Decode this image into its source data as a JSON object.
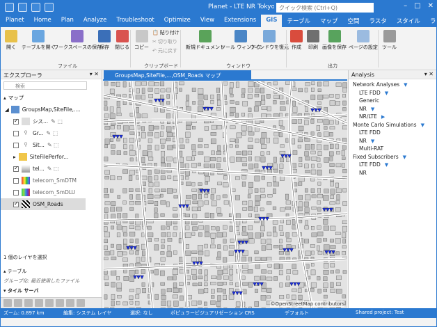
{
  "window": {
    "title": "Planet - LTE NR Tokyo S",
    "quick_search_placeholder": "クイック検索 (Ctrl+Q)",
    "controls": [
      "–",
      "□",
      "✕"
    ]
  },
  "tabs": [
    "Planet",
    "Home",
    "Plan",
    "Analyze",
    "Troubleshoot",
    "Optimize",
    "View",
    "Extensions",
    "GIS",
    "テーブル",
    "マップ",
    "空間",
    "ラスタ",
    "スタイル",
    "ラベル"
  ],
  "ribbon": {
    "file": {
      "label": "ファイル",
      "buttons": [
        "開く",
        "テーブルを開く",
        "ワークスペースの保存",
        "保存",
        "閉じる"
      ]
    },
    "clipboard": {
      "label": "クリップボード",
      "copy": "コピー",
      "paste": "貼り付け",
      "cut": "切り取り",
      "paste_special": "元に戻す"
    },
    "window": {
      "label": "ウィンドウ",
      "new_document": "新規ドキュメント",
      "tool_window": "ツール ウィンドウ",
      "restore_window": "ウィンドウを復元"
    },
    "output": {
      "label": "出力",
      "buttons": [
        "作成",
        "印刷",
        "画像を保存",
        "ページの設定"
      ]
    },
    "tools": "ツール"
  },
  "explorer": {
    "title": "エクスプローラ",
    "search_placeholder": "検索",
    "section_map": "マップ",
    "map_node": "GroupsMap,SiteFile,....",
    "layers": [
      {
        "label": "シス...",
        "checked": true,
        "icon": "layer-icon"
      },
      {
        "label": "Gr...",
        "checked": false,
        "icon": "pin-icon"
      },
      {
        "label": "Sit...",
        "checked": false,
        "icon": "pin-icon"
      },
      {
        "label": "SiteFilePerfor...",
        "checked": false,
        "icon": "folder-icon"
      },
      {
        "label": "tel...",
        "checked": true,
        "icon": "terrain-icon"
      },
      {
        "label": "telecom_SmDTM",
        "checked": false,
        "icon": "raster-icon"
      },
      {
        "label": "telecom_SmDLU",
        "checked": false,
        "icon": "raster-icon"
      },
      {
        "label": "OSM_Roads",
        "checked": true,
        "icon": "roads-icon"
      }
    ],
    "selection_info": "1 個のレイヤを選択",
    "table_section": "テーブル",
    "group_by": "グループ化: 最近使用したファイル",
    "tile_server": "タイル サーバ"
  },
  "map": {
    "tab_title": "GroupsMap,SiteFile,...,OSM_Roads マップ",
    "watermark": "©OpenStreetMap contributors"
  },
  "analysis": {
    "title": "Analysis",
    "rows": [
      {
        "label": "Network Analyses",
        "type": "cat",
        "arrow": "▼"
      },
      {
        "label": "LTE FDD",
        "type": "sub",
        "arrow": "▼"
      },
      {
        "label": "Generic",
        "type": "sub",
        "arrow": ""
      },
      {
        "label": "NR",
        "type": "sub",
        "arrow": "▼"
      },
      {
        "label": "NR/LTE",
        "type": "sub",
        "arrow": "▶"
      },
      {
        "label": "Monte Carlo Simulations",
        "type": "cat",
        "arrow": "▼"
      },
      {
        "label": "LTE FDD",
        "type": "sub",
        "arrow": ""
      },
      {
        "label": "NR",
        "type": "sub",
        "arrow": "▼"
      },
      {
        "label": "Multi-RAT",
        "type": "sub",
        "arrow": ""
      },
      {
        "label": "Fixed Subscribers",
        "type": "cat",
        "arrow": "▼"
      },
      {
        "label": "LTE FDD",
        "type": "sub",
        "arrow": "▼"
      },
      {
        "label": "NR",
        "type": "sub",
        "arrow": ""
      }
    ]
  },
  "status": {
    "zoom": "ズーム: 0.897 km",
    "edit": "編集: システム レイヤ",
    "selection": "選択: なし",
    "crs": "ポピュラービジュアリゼーション CRS",
    "default": "デフォルト",
    "project": "Shared project: Test"
  },
  "colors": {
    "accent": "#2b79d0",
    "site_marker": "#1a2ee0"
  }
}
